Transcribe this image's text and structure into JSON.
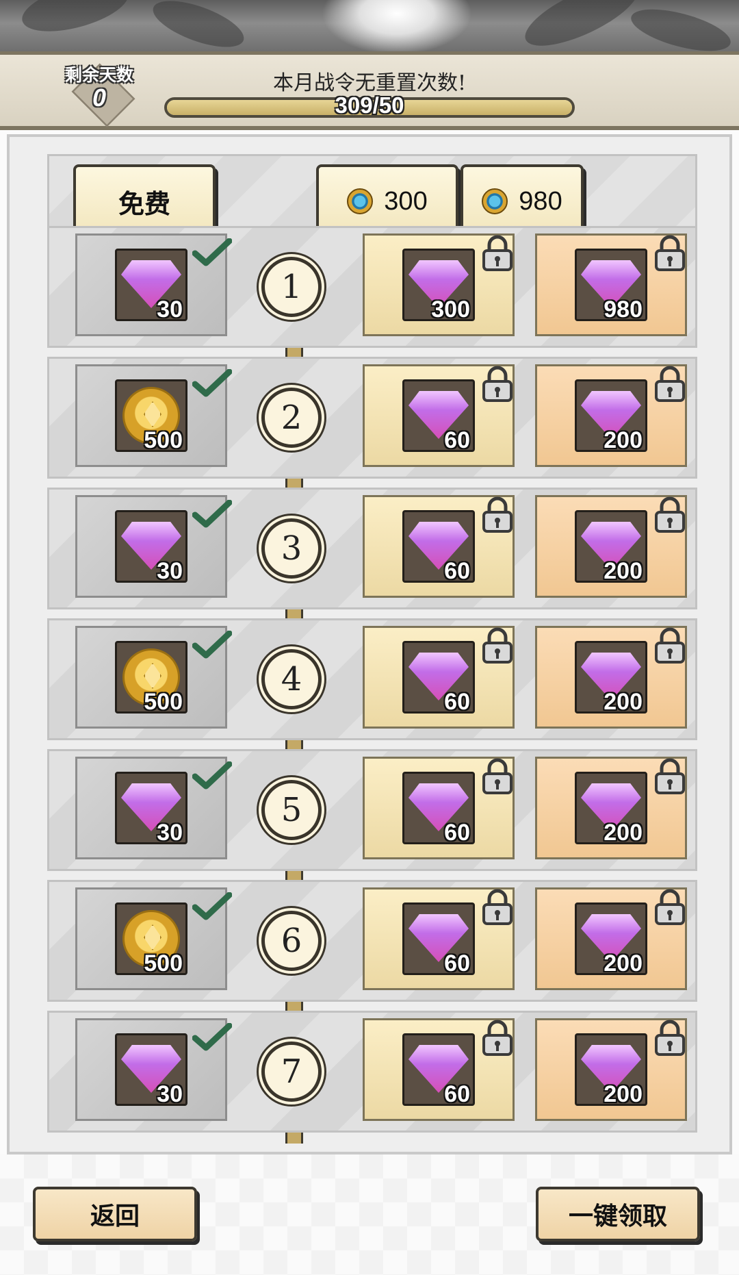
{
  "header": {
    "days_label": "剩余天数",
    "days_value": "0",
    "notice": "本月战令无重置次数!",
    "progress_text": "309/50",
    "progress_fraction": 1.0
  },
  "tiers": {
    "free_label": "免费",
    "paid1_price": "300",
    "paid2_price": "980",
    "price_icon": "coin-icon"
  },
  "rows": [
    {
      "level": "1",
      "free": {
        "icon": "gem-icon",
        "qty": "30",
        "claimed": true
      },
      "paid1": {
        "icon": "gem-icon",
        "qty": "300",
        "locked": true
      },
      "paid2": {
        "icon": "gem-icon",
        "qty": "980",
        "locked": true
      }
    },
    {
      "level": "2",
      "free": {
        "icon": "gold-coin-icon",
        "qty": "500",
        "claimed": true
      },
      "paid1": {
        "icon": "gem-icon",
        "qty": "60",
        "locked": true
      },
      "paid2": {
        "icon": "gem-icon",
        "qty": "200",
        "locked": true
      }
    },
    {
      "level": "3",
      "free": {
        "icon": "gem-icon",
        "qty": "30",
        "claimed": true
      },
      "paid1": {
        "icon": "gem-icon",
        "qty": "60",
        "locked": true
      },
      "paid2": {
        "icon": "gem-icon",
        "qty": "200",
        "locked": true
      }
    },
    {
      "level": "4",
      "free": {
        "icon": "gold-coin-icon",
        "qty": "500",
        "claimed": true
      },
      "paid1": {
        "icon": "gem-icon",
        "qty": "60",
        "locked": true
      },
      "paid2": {
        "icon": "gem-icon",
        "qty": "200",
        "locked": true
      }
    },
    {
      "level": "5",
      "free": {
        "icon": "gem-icon",
        "qty": "30",
        "claimed": true
      },
      "paid1": {
        "icon": "gem-icon",
        "qty": "60",
        "locked": true
      },
      "paid2": {
        "icon": "gem-icon",
        "qty": "200",
        "locked": true
      }
    },
    {
      "level": "6",
      "free": {
        "icon": "gold-coin-icon",
        "qty": "500",
        "claimed": true
      },
      "paid1": {
        "icon": "gem-icon",
        "qty": "60",
        "locked": true
      },
      "paid2": {
        "icon": "gem-icon",
        "qty": "200",
        "locked": true
      }
    },
    {
      "level": "7",
      "free": {
        "icon": "gem-icon",
        "qty": "30",
        "claimed": true
      },
      "paid1": {
        "icon": "gem-icon",
        "qty": "60",
        "locked": true
      },
      "paid2": {
        "icon": "gem-icon",
        "qty": "200",
        "locked": true
      }
    }
  ],
  "footer": {
    "back_label": "返回",
    "claim_all_label": "一键领取"
  },
  "colors": {
    "header_border": "#7d7561",
    "gem_pink": "#d54fb7",
    "check_green": "#2f6b4a"
  }
}
